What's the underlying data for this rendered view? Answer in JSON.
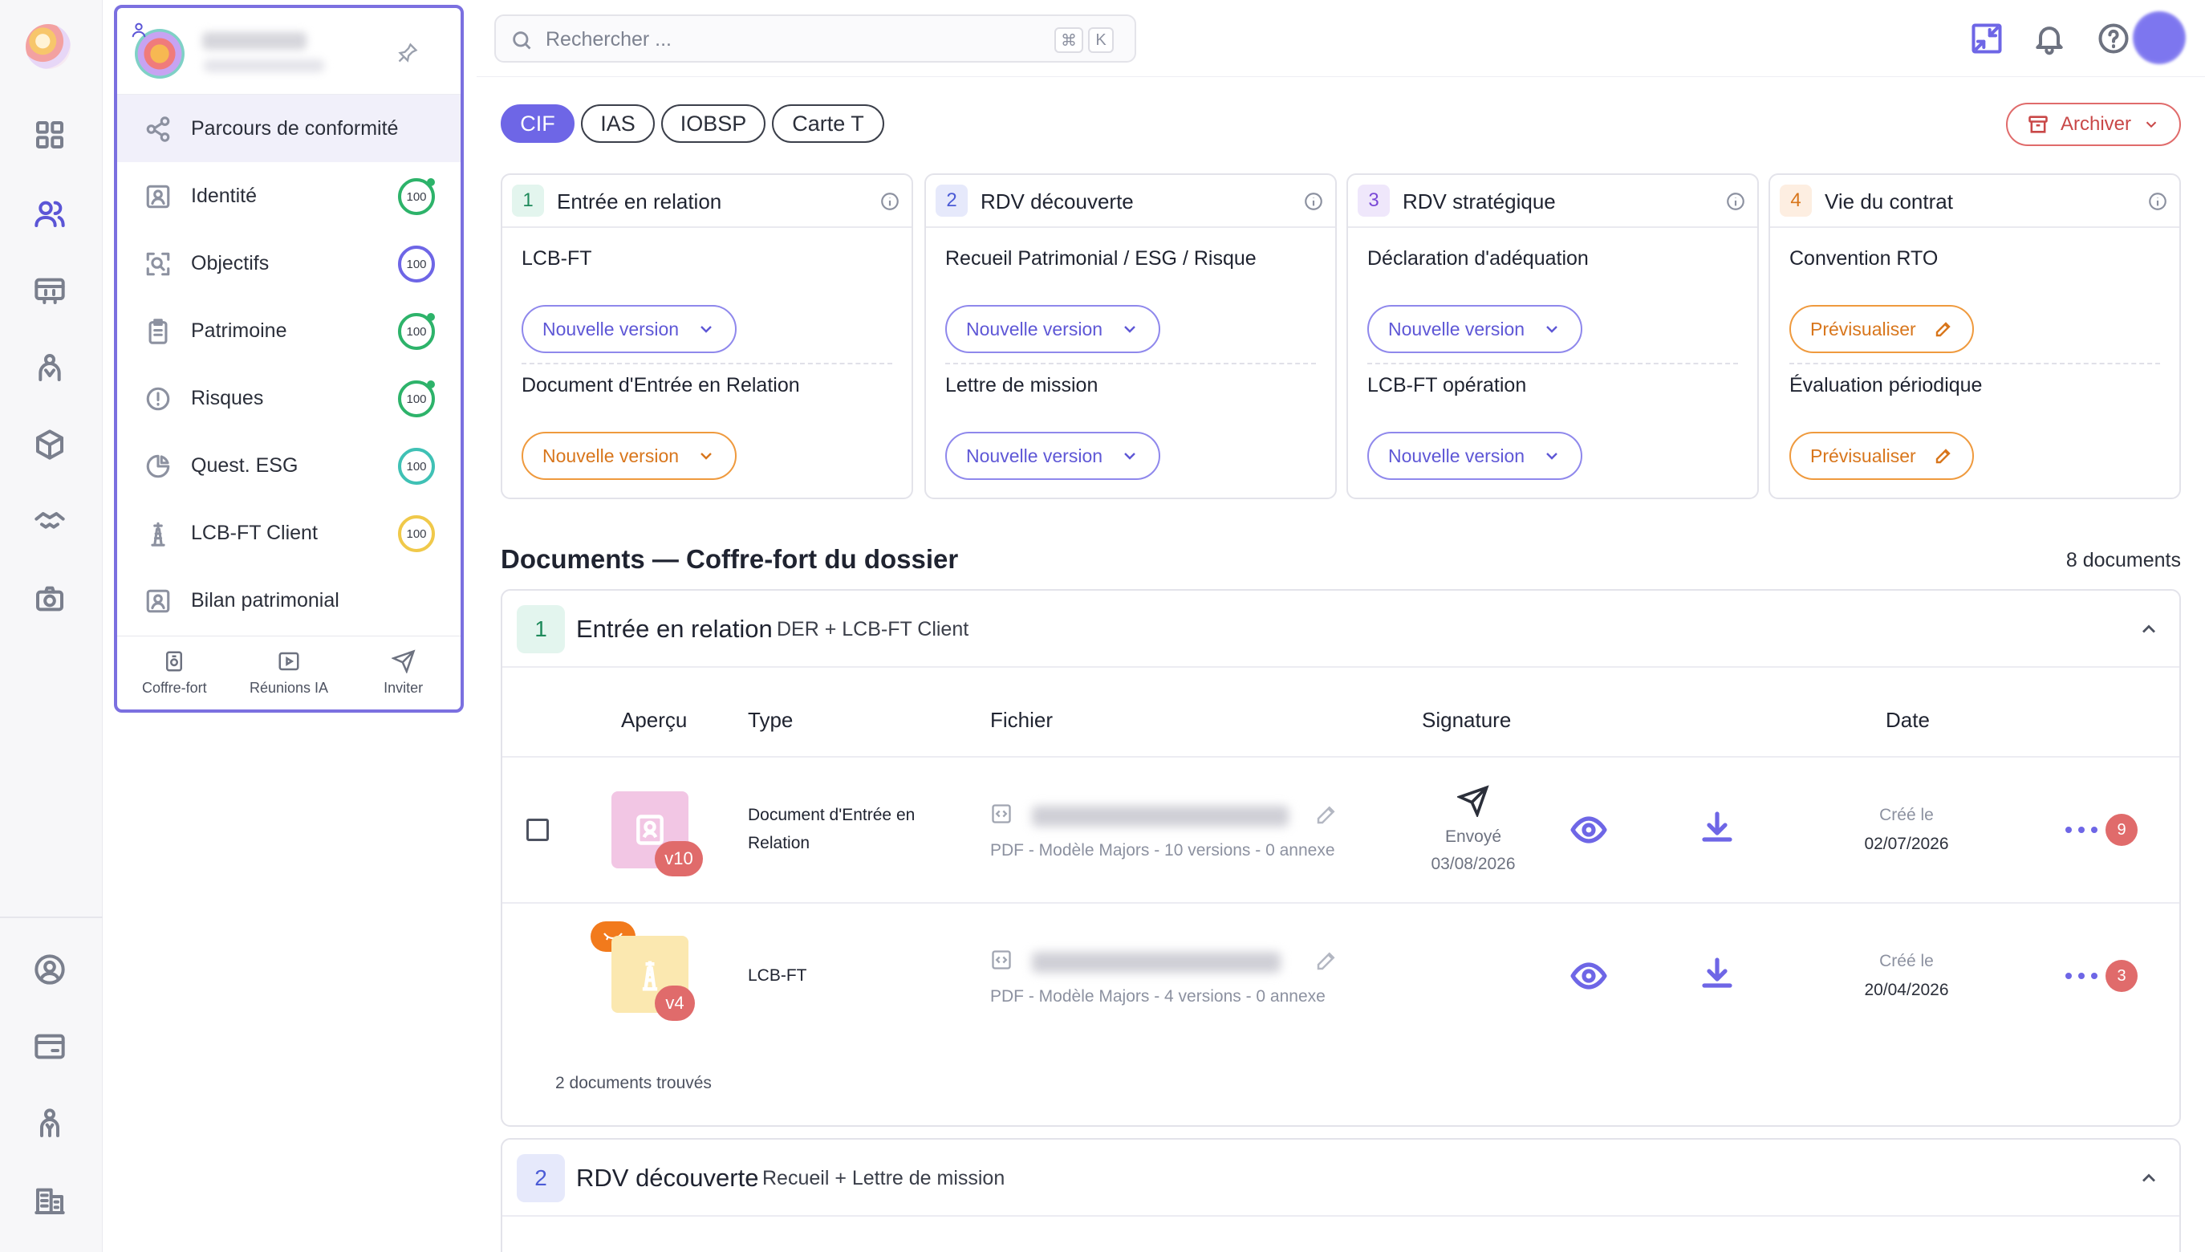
{
  "search": {
    "placeholder": "Rechercher ...",
    "kbd1": "⌘",
    "kbd2": "K"
  },
  "client_panel": {
    "items": [
      {
        "label": "Parcours de conformité",
        "icon": "graph-icon"
      },
      {
        "label": "Identité",
        "score": "100",
        "color": "#2db36a"
      },
      {
        "label": "Objectifs",
        "score": "100",
        "color": "#6e66e6"
      },
      {
        "label": "Patrimoine",
        "score": "100",
        "color": "#2db36a"
      },
      {
        "label": "Risques",
        "score": "100",
        "color": "#2db36a"
      },
      {
        "label": "Quest. ESG",
        "score": "100",
        "color": "#3fc1b5"
      },
      {
        "label": "LCB-FT Client",
        "score": "100",
        "color": "#f0c94a"
      },
      {
        "label": "Bilan patrimonial"
      }
    ],
    "footer": [
      {
        "label": "Coffre-fort"
      },
      {
        "label": "Réunions IA"
      },
      {
        "label": "Inviter"
      }
    ]
  },
  "regimes": [
    "CIF",
    "IAS",
    "IOBSP",
    "Carte T"
  ],
  "archive_label": "Archiver",
  "steps": [
    {
      "num": "1",
      "title": "Entrée en relation",
      "num_bg": "#e3f5ee",
      "num_color": "#1f8a5b",
      "doc1": "LCB-FT",
      "btn1": "Nouvelle version",
      "doc2": "Document d'Entrée en Relation",
      "btn2": "Nouvelle version"
    },
    {
      "num": "2",
      "title": "RDV découverte",
      "num_bg": "#e6e9fb",
      "num_color": "#4b5bd6",
      "doc1": "Recueil Patrimonial / ESG / Risque",
      "btn1": "Nouvelle version",
      "doc2": "Lettre de mission",
      "btn2": "Nouvelle version"
    },
    {
      "num": "3",
      "title": "RDV stratégique",
      "num_bg": "#efe7fb",
      "num_color": "#7a49d6",
      "doc1": "Déclaration d'adéquation",
      "btn1": "Nouvelle version",
      "doc2": "LCB-FT opération",
      "btn2": "Nouvelle version"
    },
    {
      "num": "4",
      "title": "Vie du contrat",
      "num_bg": "#fdeee1",
      "num_color": "#d8761c",
      "doc1": "Convention RTO",
      "btn1": "Prévisualiser",
      "doc2": "Évaluation périodique",
      "btn2": "Prévisualiser"
    }
  ],
  "documents": {
    "title": "Documents — Coffre-fort du dossier",
    "count": "8 documents",
    "sections": [
      {
        "num": "1",
        "title": "Entrée en relation",
        "subtitle": "DER + LCB-FT Client"
      },
      {
        "num": "2",
        "title": "RDV découverte",
        "subtitle": "Recueil + Lettre de mission"
      }
    ],
    "columns": [
      "Aperçu",
      "Type",
      "Fichier",
      "Signature",
      "Date"
    ],
    "rows": [
      {
        "version": "v10",
        "type": "Document d'Entrée en Relation",
        "meta": "PDF - Modèle Majors - 10 versions - 0 annexe",
        "signature_status": "Envoyé",
        "signature_date": "03/08/2026",
        "date_label": "Créé le",
        "date": "02/07/2026",
        "badge": "9"
      },
      {
        "version": "v4",
        "type": "LCB-FT",
        "meta": "PDF - Modèle Majors - 4 versions - 0 annexe",
        "date_label": "Créé le",
        "date": "20/04/2026",
        "badge": "3"
      }
    ],
    "found": "2 documents trouvés"
  },
  "colors": {
    "accent": "#6e66e6",
    "orange": "#d8761c",
    "danger": "#e06b6b"
  }
}
